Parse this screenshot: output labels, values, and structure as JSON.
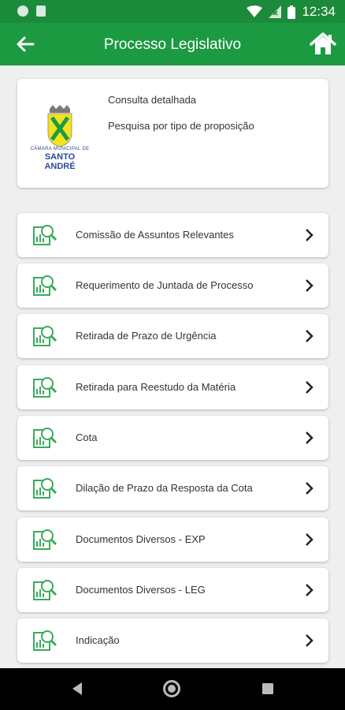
{
  "status_bar": {
    "time": "12:34"
  },
  "app_bar": {
    "title": "Processo Legislativo"
  },
  "header_card": {
    "logo_caption_top": "CÂMARA MUNICIPAL DE",
    "logo_caption_bottom": "SANTO ANDRÉ",
    "links": [
      "Consulta detalhada",
      "Pesquisa por tipo de proposição"
    ]
  },
  "items": [
    {
      "label": "Comissão de Assuntos Relevantes"
    },
    {
      "label": "Requerimento de Juntada de Processo"
    },
    {
      "label": "Retirada de Prazo de Urgência"
    },
    {
      "label": "Retirada para Reestudo da Matéria"
    },
    {
      "label": "Cota"
    },
    {
      "label": "Dilação de Prazo da Resposta da Cota"
    },
    {
      "label": "Documentos Diversos - EXP"
    },
    {
      "label": "Documentos Diversos - LEG"
    },
    {
      "label": "Indicação"
    }
  ],
  "colors": {
    "status_bar": "#1b8a3a",
    "app_bar": "#1b9a42",
    "accent": "#3aaa5c",
    "background": "#efefef"
  },
  "icons": {
    "back": "arrow-left-icon",
    "home": "home-icon",
    "item": "document-search-icon",
    "chevron": "chevron-right-icon"
  }
}
